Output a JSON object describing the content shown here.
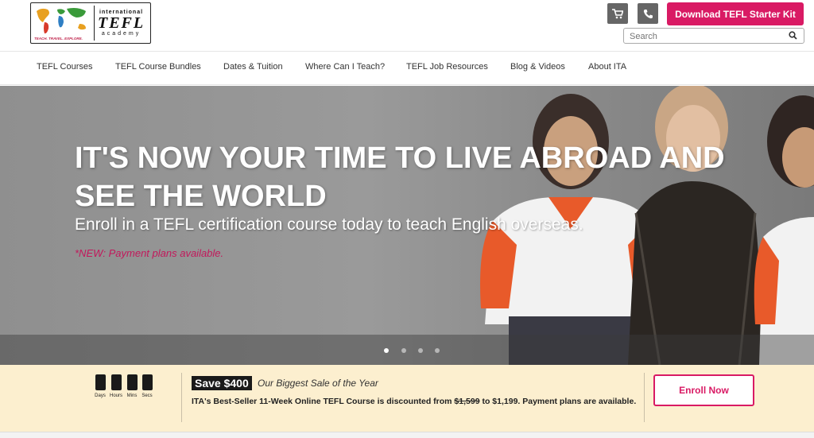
{
  "header": {
    "logo": {
      "top_text": "international",
      "main_text": "TEFL",
      "bottom_text": "academy",
      "tagline": "TEACH. TRAVEL. EXPLORE."
    },
    "cart_icon": "cart-icon",
    "phone_icon": "phone-icon",
    "download_label": "Download TEFL Starter Kit",
    "search_placeholder": "Search",
    "accent_color": "#d91a64"
  },
  "nav": {
    "items": [
      {
        "label": "TEFL Courses"
      },
      {
        "label": "TEFL Course Bundles"
      },
      {
        "label": "Dates & Tuition"
      },
      {
        "label": "Where Can I Teach?"
      },
      {
        "label": "TEFL Job Resources"
      },
      {
        "label": "Blog & Videos"
      },
      {
        "label": "About ITA"
      }
    ]
  },
  "hero": {
    "title": "IT'S NOW YOUR TIME TO LIVE ABROAD AND SEE THE WORLD",
    "subtitle": "Enroll in a TEFL certification course today to teach English overseas.",
    "note": "*NEW: Payment plans available.",
    "slide_count": 4,
    "active_slide": 1
  },
  "promo": {
    "timer_labels": [
      "Days",
      "Hours",
      "Mins",
      "Secs"
    ],
    "badge": "Save $400",
    "badge_sub": "Our Biggest Sale of the Year",
    "desc_before": "ITA's Best-Seller 11-Week Online TEFL Course is discounted from ",
    "old_price": "$1,599",
    "desc_after": " to $1,199. Payment plans are available.",
    "enroll_label": "Enroll Now"
  }
}
